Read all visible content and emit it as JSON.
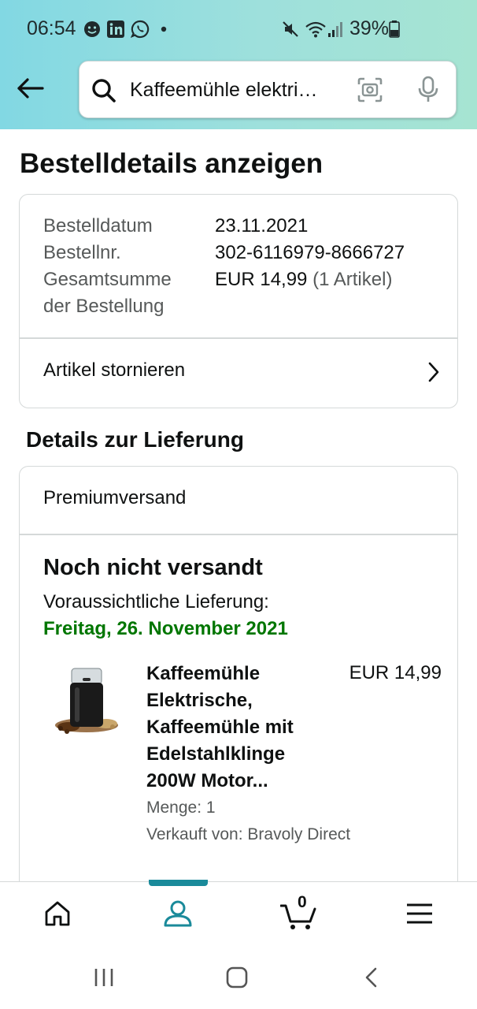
{
  "status_bar": {
    "time": "06:54",
    "battery": "39%"
  },
  "search": {
    "query": "Kaffeemühle elektri…"
  },
  "page": {
    "title": "Bestelldetails anzeigen"
  },
  "order_summary": {
    "date_label": "Bestelldatum",
    "date_value": "23.11.2021",
    "number_label": "Bestellnr.",
    "number_value": "302-6116979-8666727",
    "total_label_line1": "Gesamtsumme",
    "total_label_line2": "der Bestellung",
    "total_value": "EUR 14,99",
    "total_items": "(1 Artikel)",
    "cancel_label": "Artikel stornieren"
  },
  "delivery": {
    "section_title": "Details zur Lieferung",
    "shipping_type": "Premiumversand",
    "status": "Noch nicht versandt",
    "eta_label": "Voraussichtliche Lieferung:",
    "eta_date": "Freitag, 26. November 2021"
  },
  "product": {
    "title_line1": "Kaffeemühle",
    "title_line2": "Elektrische,",
    "title_line3": "Kaffeemühle mit",
    "title_line4": "Edelstahlklinge",
    "title_line5": "200W Motor...",
    "price": "EUR 14,99",
    "quantity": "Menge: 1",
    "seller": "Verkauft von: Bravoly Direct"
  },
  "bottom_nav": {
    "cart_count": "0",
    "active_tab": "account"
  },
  "colors": {
    "delivery_green": "#007600",
    "accent_teal": "#1a8a9a",
    "header_gradient_start": "#82d8e3",
    "header_gradient_end": "#a6e4d2"
  }
}
